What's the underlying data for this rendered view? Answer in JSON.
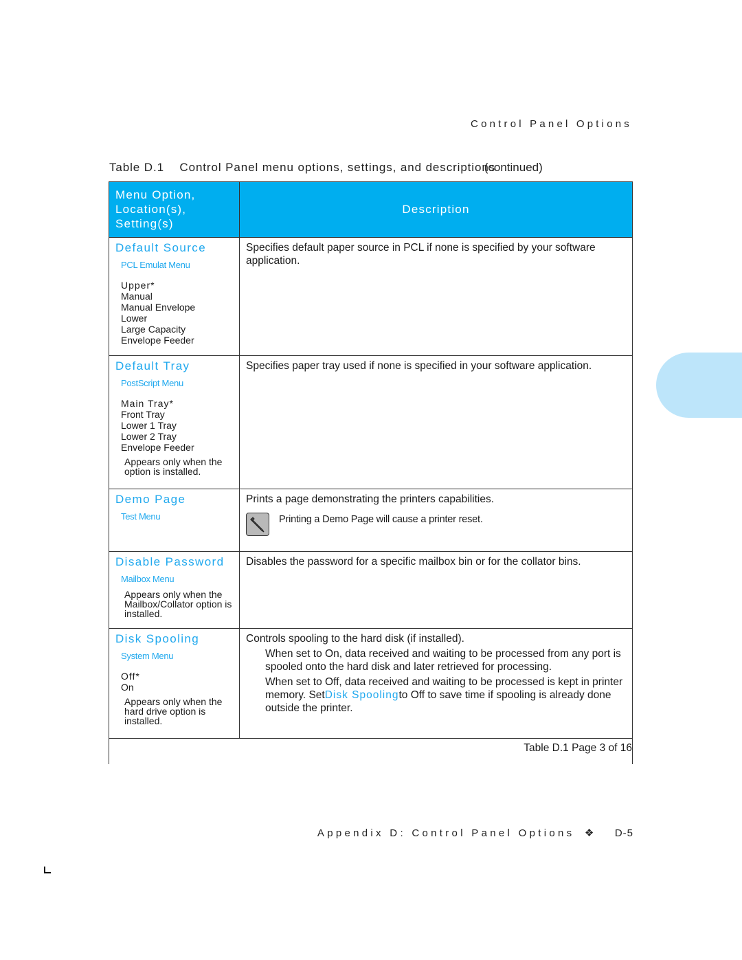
{
  "running_head": "Control Panel Options",
  "table_caption": {
    "label": "Table D.1",
    "title": "Control Panel menu options, settings, and descriptions",
    "continued": "(continued)"
  },
  "table": {
    "header": {
      "left_lines": [
        "Menu Option,",
        "Location(s),",
        "Setting(s)"
      ],
      "right": "Description"
    },
    "rows": [
      {
        "option": "Default Source",
        "menu": "PCL Emulat Menu",
        "settings": [
          "Upper*",
          "Manual",
          "Manual Envelope",
          "Lower",
          "Large Capacity",
          "Envelope Feeder"
        ],
        "description": "Specifies default paper source in PCL if none is specified by your software application."
      },
      {
        "option": "Default Tray",
        "menu": "PostScript Menu",
        "settings": [
          "Main Tray*",
          "Front Tray",
          "Lower 1 Tray",
          "Lower 2 Tray",
          "Envelope Feeder"
        ],
        "note": "Appears only when the option is installed.",
        "description": "Specifies paper tray used if none is specified in your software application."
      },
      {
        "option": "Demo Page",
        "menu": "Test Menu",
        "description": "Prints a page demonstrating the printers capabilities.",
        "callout": {
          "icon": "pencil-note-icon",
          "text": "Printing a Demo Page will cause a printer reset."
        }
      },
      {
        "option": "Disable Password",
        "menu": "Mailbox Menu",
        "note": "Appears only when the Mailbox/Collator option is installed.",
        "description": "Disables the password for a specific mailbox bin or for the collator bins."
      },
      {
        "option": "Disk Spooling",
        "menu": "System Menu",
        "settings": [
          "Off*",
          "On"
        ],
        "note": "Appears only when the hard drive option is installed.",
        "description": "Controls spooling to the hard disk (if installed).",
        "bullets": [
          {
            "text": "When set to On, data received and waiting to be processed from any port is spooled onto the hard disk and later retrieved for processing."
          },
          {
            "pre": "When set to Off, data received and waiting to be processed is kept in printer memory. Set",
            "link": "Disk Spooling",
            "post": "to Off to save time if spooling is already done outside the printer."
          }
        ]
      }
    ],
    "footer": "Table D.1  Page 3 of 16"
  },
  "page_footer": {
    "text": "Appendix D: Control Panel Options",
    "separator": "❖",
    "page_number": "D-5"
  },
  "colors": {
    "header_bg": "#00aeef",
    "accent_text": "#1fa8ee",
    "side_tab": "#bde5fa"
  }
}
